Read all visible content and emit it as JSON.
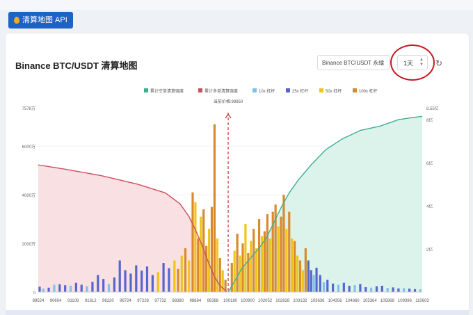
{
  "api_tag": {
    "label": "清算地图 API"
  },
  "header": {
    "title": "Binance BTC/USDT 清算地图"
  },
  "controls": {
    "pair_select": "Binance BTC/USDT 永续",
    "period_select": "1天"
  },
  "colors": {
    "short_cum": "#3fae8f",
    "long_cum": "#c8515e",
    "lev10": "#7ec2e6",
    "lev25": "#5566cc",
    "lev50": "#f0c419",
    "lev100": "#d98a2c",
    "short_fill": "#d8f2ea",
    "long_fill": "#f7dde0",
    "price_line": "#c8342f"
  },
  "chart_data": {
    "type": "bar",
    "legend_position": "top",
    "legend": [
      "累计空单清算强度",
      "累计多单清算强度",
      "10x 杠杆",
      "25x 杠杆",
      "50x 杠杆",
      "100x 杠杆"
    ],
    "current_price_label": "当前价格:99950",
    "current_price": 99950,
    "x_range": [
      89524,
      110602
    ],
    "x_tick_labels": [
      "89524",
      "90604",
      "91108",
      "91612",
      "96220",
      "96724",
      "97228",
      "97732",
      "98380",
      "98884",
      "99388",
      "100180",
      "100900",
      "102052",
      "102628",
      "103132",
      "103636",
      "104356",
      "104860",
      "105364",
      "105868",
      "109396",
      "110602"
    ],
    "y_left": {
      "ticks": [
        "0",
        "2000万",
        "4000万",
        "6000万",
        "7578万"
      ],
      "values": [
        0,
        2000,
        4000,
        6000,
        7578
      ],
      "max": 7578
    },
    "y_right": {
      "ticks": [
        "2亿",
        "4亿",
        "6亿",
        "8亿",
        "8.55亿"
      ],
      "values": [
        2,
        4,
        6,
        8,
        8.55
      ],
      "max": 8.55
    },
    "long_cumulative": [
      [
        89524,
        5.9
      ],
      [
        91000,
        5.7
      ],
      [
        93000,
        5.4
      ],
      [
        95000,
        5.0
      ],
      [
        96500,
        4.6
      ],
      [
        97300,
        4.1
      ],
      [
        97800,
        3.5
      ],
      [
        98200,
        2.8
      ],
      [
        98600,
        2.0
      ],
      [
        98900,
        1.3
      ],
      [
        99200,
        0.7
      ],
      [
        99500,
        0.3
      ],
      [
        99900,
        0.0
      ]
    ],
    "short_cumulative": [
      [
        99950,
        0.0
      ],
      [
        100300,
        0.5
      ],
      [
        100700,
        1.1
      ],
      [
        101200,
        1.6
      ],
      [
        101700,
        2.1
      ],
      [
        102100,
        2.6
      ],
      [
        102500,
        3.3
      ],
      [
        102900,
        4.0
      ],
      [
        103300,
        4.6
      ],
      [
        103800,
        5.2
      ],
      [
        104500,
        5.9
      ],
      [
        105300,
        6.6
      ],
      [
        106200,
        7.1
      ],
      [
        107200,
        7.5
      ],
      [
        108300,
        7.7
      ],
      [
        109300,
        8.0
      ],
      [
        110100,
        8.1
      ],
      [
        110602,
        8.15
      ]
    ],
    "bars_price_range": [
      89524,
      110602
    ],
    "bars": [
      {
        "x": 89600,
        "lev": "lev25",
        "v": 220
      },
      {
        "x": 89800,
        "lev": "lev10",
        "v": 140
      },
      {
        "x": 90100,
        "lev": "lev25",
        "v": 180
      },
      {
        "x": 90400,
        "lev": "lev10",
        "v": 300
      },
      {
        "x": 90700,
        "lev": "lev25",
        "v": 320
      },
      {
        "x": 91000,
        "lev": "lev25",
        "v": 280
      },
      {
        "x": 91300,
        "lev": "lev10",
        "v": 260
      },
      {
        "x": 91600,
        "lev": "lev25",
        "v": 380
      },
      {
        "x": 91900,
        "lev": "lev25",
        "v": 300
      },
      {
        "x": 92200,
        "lev": "lev10",
        "v": 240
      },
      {
        "x": 92500,
        "lev": "lev25",
        "v": 420
      },
      {
        "x": 92800,
        "lev": "lev25",
        "v": 700
      },
      {
        "x": 93100,
        "lev": "lev25",
        "v": 540
      },
      {
        "x": 93400,
        "lev": "lev10",
        "v": 330
      },
      {
        "x": 93700,
        "lev": "lev25",
        "v": 600
      },
      {
        "x": 94000,
        "lev": "lev25",
        "v": 1300
      },
      {
        "x": 94300,
        "lev": "lev25",
        "v": 900
      },
      {
        "x": 94600,
        "lev": "lev25",
        "v": 760
      },
      {
        "x": 94900,
        "lev": "lev25",
        "v": 1100
      },
      {
        "x": 95200,
        "lev": "lev25",
        "v": 880
      },
      {
        "x": 95500,
        "lev": "lev25",
        "v": 1050
      },
      {
        "x": 95800,
        "lev": "lev25",
        "v": 700
      },
      {
        "x": 96100,
        "lev": "lev50",
        "v": 820
      },
      {
        "x": 96400,
        "lev": "lev25",
        "v": 1200
      },
      {
        "x": 96700,
        "lev": "lev25",
        "v": 980
      },
      {
        "x": 97000,
        "lev": "lev50",
        "v": 1300
      },
      {
        "x": 97200,
        "lev": "lev100",
        "v": 950
      },
      {
        "x": 97400,
        "lev": "lev50",
        "v": 1500
      },
      {
        "x": 97600,
        "lev": "lev100",
        "v": 1800
      },
      {
        "x": 97800,
        "lev": "lev50",
        "v": 1300
      },
      {
        "x": 98000,
        "lev": "lev100",
        "v": 4100
      },
      {
        "x": 98150,
        "lev": "lev50",
        "v": 3700
      },
      {
        "x": 98300,
        "lev": "lev100",
        "v": 2200
      },
      {
        "x": 98450,
        "lev": "lev50",
        "v": 3100
      },
      {
        "x": 98600,
        "lev": "lev100",
        "v": 3400
      },
      {
        "x": 98750,
        "lev": "lev100",
        "v": 1900
      },
      {
        "x": 98900,
        "lev": "lev50",
        "v": 2600
      },
      {
        "x": 99050,
        "lev": "lev100",
        "v": 3500
      },
      {
        "x": 99200,
        "lev": "lev100",
        "v": 6900
      },
      {
        "x": 99350,
        "lev": "lev50",
        "v": 2200
      },
      {
        "x": 99500,
        "lev": "lev100",
        "v": 1400
      },
      {
        "x": 99650,
        "lev": "lev50",
        "v": 900
      },
      {
        "x": 99800,
        "lev": "lev100",
        "v": 500
      },
      {
        "x": 100150,
        "lev": "lev100",
        "v": 1200
      },
      {
        "x": 100300,
        "lev": "lev50",
        "v": 1700
      },
      {
        "x": 100450,
        "lev": "lev100",
        "v": 2400
      },
      {
        "x": 100600,
        "lev": "lev50",
        "v": 1500
      },
      {
        "x": 100750,
        "lev": "lev100",
        "v": 2000
      },
      {
        "x": 100900,
        "lev": "lev50",
        "v": 2800
      },
      {
        "x": 101050,
        "lev": "lev100",
        "v": 1600
      },
      {
        "x": 101200,
        "lev": "lev50",
        "v": 2100
      },
      {
        "x": 101350,
        "lev": "lev100",
        "v": 2600
      },
      {
        "x": 101500,
        "lev": "lev50",
        "v": 1800
      },
      {
        "x": 101650,
        "lev": "lev100",
        "v": 3000
      },
      {
        "x": 101800,
        "lev": "lev50",
        "v": 2300
      },
      {
        "x": 101950,
        "lev": "lev100",
        "v": 2500
      },
      {
        "x": 102100,
        "lev": "lev100",
        "v": 3200
      },
      {
        "x": 102250,
        "lev": "lev50",
        "v": 2200
      },
      {
        "x": 102400,
        "lev": "lev100",
        "v": 3300
      },
      {
        "x": 102550,
        "lev": "lev100",
        "v": 3600
      },
      {
        "x": 102700,
        "lev": "lev50",
        "v": 2700
      },
      {
        "x": 102850,
        "lev": "lev100",
        "v": 3100
      },
      {
        "x": 103000,
        "lev": "lev100",
        "v": 4000
      },
      {
        "x": 103150,
        "lev": "lev50",
        "v": 2600
      },
      {
        "x": 103300,
        "lev": "lev100",
        "v": 3300
      },
      {
        "x": 103450,
        "lev": "lev50",
        "v": 2200
      },
      {
        "x": 103600,
        "lev": "lev100",
        "v": 2100
      },
      {
        "x": 103750,
        "lev": "lev50",
        "v": 1500
      },
      {
        "x": 103900,
        "lev": "lev100",
        "v": 1300
      },
      {
        "x": 104050,
        "lev": "lev50",
        "v": 900
      },
      {
        "x": 104200,
        "lev": "lev100",
        "v": 1800
      },
      {
        "x": 104350,
        "lev": "lev25",
        "v": 1300
      },
      {
        "x": 104500,
        "lev": "lev25",
        "v": 900
      },
      {
        "x": 104650,
        "lev": "lev10",
        "v": 700
      },
      {
        "x": 104800,
        "lev": "lev25",
        "v": 1000
      },
      {
        "x": 105000,
        "lev": "lev25",
        "v": 700
      },
      {
        "x": 105200,
        "lev": "lev10",
        "v": 400
      },
      {
        "x": 105400,
        "lev": "lev25",
        "v": 500
      },
      {
        "x": 105700,
        "lev": "lev25",
        "v": 350
      },
      {
        "x": 106000,
        "lev": "lev10",
        "v": 300
      },
      {
        "x": 106300,
        "lev": "lev25",
        "v": 380
      },
      {
        "x": 106600,
        "lev": "lev25",
        "v": 260
      },
      {
        "x": 106900,
        "lev": "lev10",
        "v": 280
      },
      {
        "x": 107200,
        "lev": "lev25",
        "v": 330
      },
      {
        "x": 107500,
        "lev": "lev25",
        "v": 200
      },
      {
        "x": 107800,
        "lev": "lev10",
        "v": 180
      },
      {
        "x": 108100,
        "lev": "lev25",
        "v": 240
      },
      {
        "x": 108400,
        "lev": "lev25",
        "v": 260
      },
      {
        "x": 108700,
        "lev": "lev10",
        "v": 170
      },
      {
        "x": 109000,
        "lev": "lev25",
        "v": 190
      },
      {
        "x": 109300,
        "lev": "lev25",
        "v": 150
      },
      {
        "x": 109600,
        "lev": "lev10",
        "v": 160
      },
      {
        "x": 109900,
        "lev": "lev25",
        "v": 140
      },
      {
        "x": 110200,
        "lev": "lev25",
        "v": 120
      },
      {
        "x": 110500,
        "lev": "lev10",
        "v": 110
      }
    ]
  }
}
